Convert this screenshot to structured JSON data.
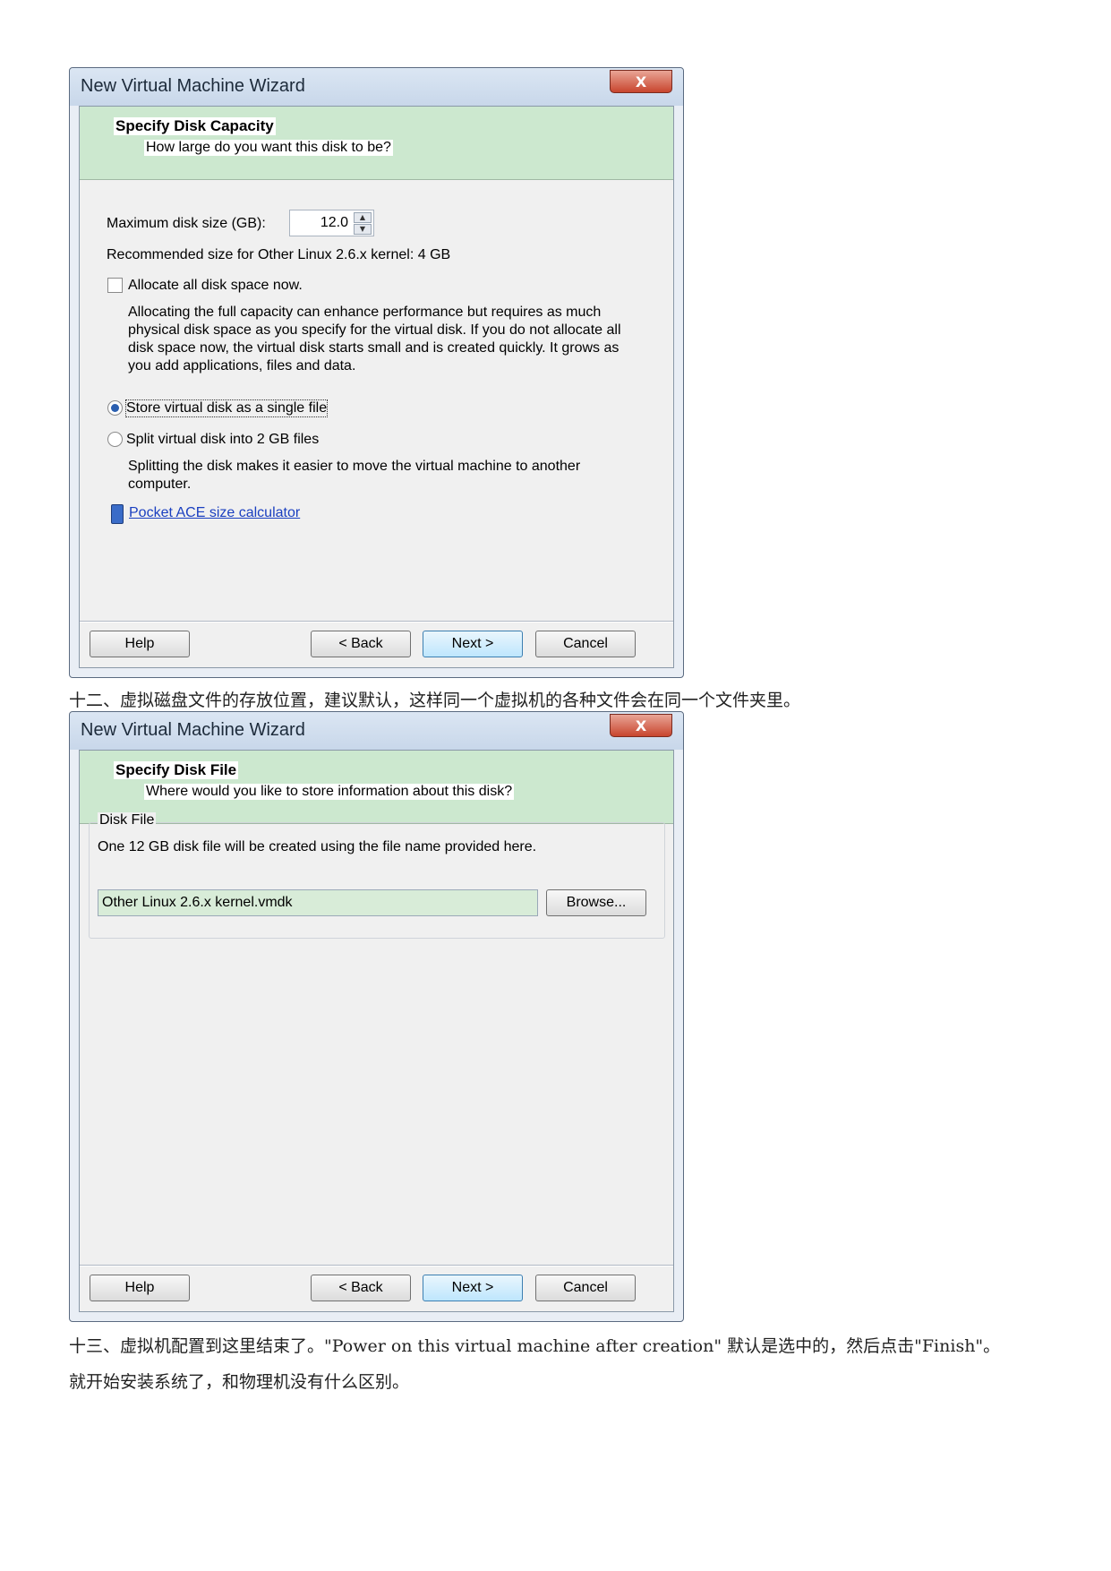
{
  "dialog1": {
    "title": "New Virtual Machine Wizard",
    "close": "X",
    "header_title": "Specify Disk Capacity",
    "header_subtitle": "How large do you want this disk to be?",
    "max_size_label": "Maximum disk size (GB):",
    "max_size_value": "12.0",
    "recommended": "Recommended size for Other Linux 2.6.x kernel: 4 GB",
    "allocate_label": "Allocate all disk space now.",
    "allocate_desc_lines": [
      "Allocating the full capacity can enhance performance but requires as much",
      "physical disk space as you specify for the virtual disk. If you do not allocate all",
      "disk space now, the virtual disk starts small and is created quickly. It grows as",
      "you add applications, files and data."
    ],
    "single_file_label": "Store virtual disk as a single file",
    "split_label": "Split virtual disk into 2 GB files",
    "split_desc_lines": [
      "Splitting the disk makes it easier to move the virtual machine to another",
      "computer."
    ],
    "calculator_link": "Pocket ACE size calculator",
    "buttons": {
      "help": "Help",
      "back": "< Back",
      "next": "Next >",
      "cancel": "Cancel"
    }
  },
  "caption12": "十二、虚拟磁盘文件的存放位置，建议默认，这样同一个虚拟机的各种文件会在同一个文件夹里。",
  "dialog2": {
    "title": "New Virtual Machine Wizard",
    "close": "X",
    "header_title": "Specify Disk File",
    "header_subtitle": "Where would you like to store information about this disk?",
    "group_label": "Disk File",
    "description": "One 12 GB disk file will be created using the file name provided here.",
    "file_name": "Other Linux 2.6.x kernel.vmdk",
    "browse": "Browse...",
    "buttons": {
      "help": "Help",
      "back": "< Back",
      "next": "Next >",
      "cancel": "Cancel"
    }
  },
  "caption13_line1": "十三、虚拟机配置到这里结束了。\"Power on this virtual machine after creation\" 默认是选中的，然后点击\"Finish\"。",
  "caption13_line2": "就开始安装系统了，和物理机没有什么区别。"
}
